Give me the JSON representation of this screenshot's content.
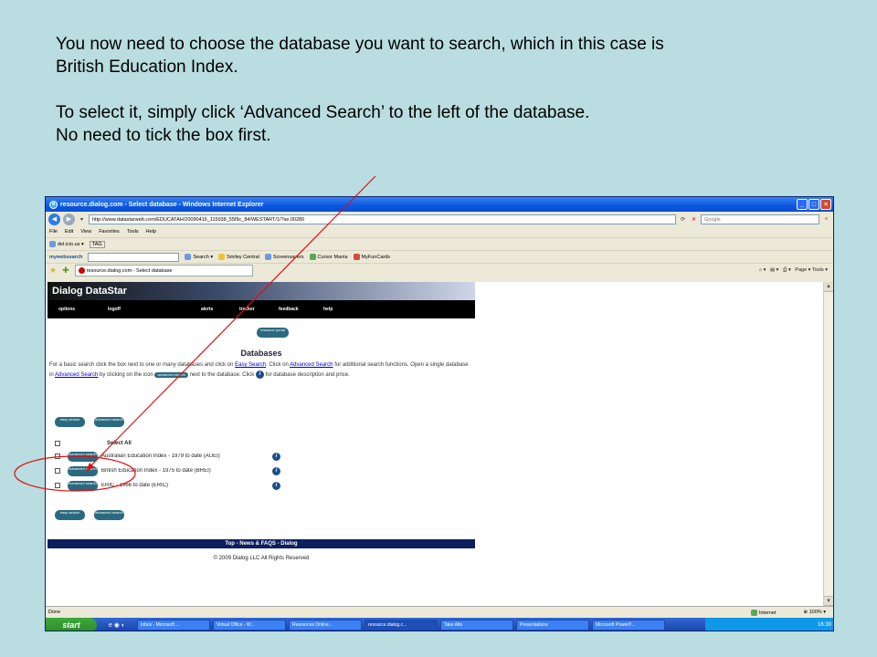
{
  "caption": {
    "line1": "You now need to choose the database you want to search, which in this case is",
    "line2": "British Education Index.",
    "line3": "To select it, simply click ‘Advanced Search’ to the left of the database.",
    "line4": "No need to tick the box first."
  },
  "window": {
    "title": "resource.dialog.com - Select database - Windows Internet Explorer"
  },
  "address": {
    "url": "http://www.datastarweb.com/EDUCATAH/20090416_115938_55f9c_84/WESTART/1/?se.00280",
    "search_placeholder": "Google"
  },
  "menu": [
    "File",
    "Edit",
    "View",
    "Favorites",
    "Tools",
    "Help"
  ],
  "toolbar": {
    "delicious": "del.icio.us",
    "tag": "TAG",
    "mywebsearch": "mywebsearch",
    "search": "Search",
    "smiley": "Smiley Central",
    "screensavers": "Screensavers",
    "cursor": "Cursor Mania",
    "funcards": "MyFunCards"
  },
  "tab": {
    "label": "resource.dialog.com - Select database",
    "tools": "Page ▾  Tools ▾"
  },
  "site": {
    "logo": "Dialog DataStar",
    "nav": [
      "options",
      "logoff",
      "alerts",
      "tracker",
      "feedback",
      "help"
    ],
    "portal": "resource portal",
    "heading": "Databases",
    "intro_a": "For a basic search click the box next to one or many databases and click on ",
    "easy_link": "Easy Search",
    "intro_b": ". Click on ",
    "adv_link": "Advanced Search",
    "intro_c": " for additional search functions. Open a single database in ",
    "adv_link2": "Advanced Search",
    "intro_d": " by clicking on the icon ",
    "intro_e": " next to the database. Click ",
    "intro_f": " for database description and price.",
    "easy_btn": "easy search",
    "adv_btn": "advanced search",
    "select_all": "Select All",
    "databases": [
      "Australian Education Index - 1979 to date (AUEI)",
      "British Education Index - 1975 to date (BREI)",
      "ERIC - 1966 to date (ERIC)"
    ],
    "footer": "Top - News & FAQS - Dialog",
    "copyright": "© 2009 Dialog LLC All Rights Reserved"
  },
  "status": {
    "left": "Done",
    "zone": "Internet",
    "zoom": "100%"
  },
  "taskbar": {
    "start": "start",
    "tasks": [
      "Inbox - Microsoft ...",
      "Virtual Office - W...",
      "Resources Online...",
      "resource.dialog.c...",
      "Take Alto",
      "Presentations",
      "Microsoft PowerP..."
    ],
    "clock": "16:39"
  },
  "annotation": {
    "color": "#e01010"
  }
}
